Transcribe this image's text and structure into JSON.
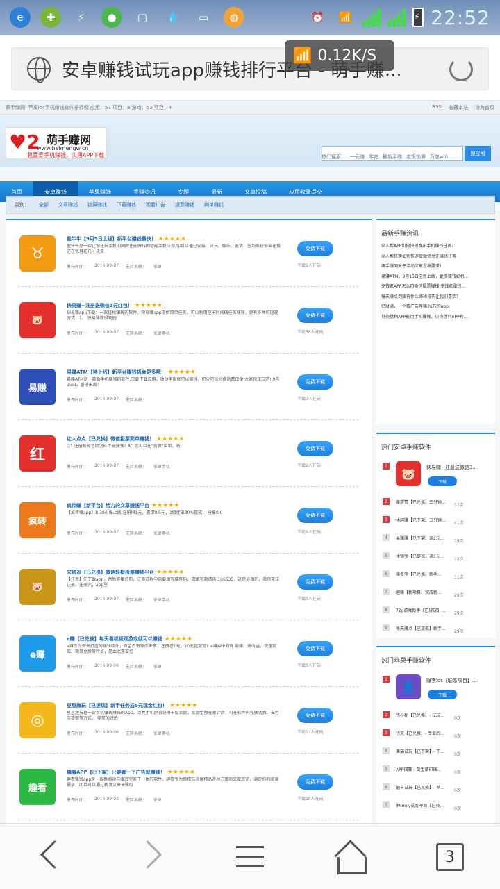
{
  "status": {
    "speed": "0.12K/S",
    "time": "22:52",
    "net1": "3G",
    "net2": "G"
  },
  "browser": {
    "title": "安卓赚钱试玩app赚钱排行平台 - 萌手赚...",
    "tabs_count": "3"
  },
  "site": {
    "top_left": "萌手赚网- 苹果ios手机赚钱软件排行榜   应用：57 项目：8 游戏：53 项目：4",
    "top_links": [
      "RSS",
      "收藏本站",
      "设为首页"
    ],
    "logo_name": "萌手赚网",
    "logo_url": "www.heimengw.cn",
    "logo_slogan": "我喜爱手机赚钱、实用APP下载",
    "search_button": "搜应用",
    "hot_label": "热门搜索：",
    "hot": [
      "一元赚",
      "零花",
      "最新手赚",
      "老板锁屏",
      "万能wifi"
    ],
    "nav": [
      "首页",
      "安卓赚钱",
      "苹果赚钱",
      "手赚资讯",
      "专题",
      "最新",
      "文章投稿",
      "应用收录提交"
    ],
    "cat_label": "类别：",
    "cats": [
      "全部",
      "文章赚钱",
      "锁屏赚钱",
      "下载赚钱",
      "观看广告",
      "投票赚钱",
      "刷单赚钱"
    ]
  },
  "items": [
    {
      "title": "盈牛牛【9月5日上线】新平台赚钱最快！",
      "stars": "★★★★★",
      "desc": "盈牛牛是一款让你在玩手机的同时还能赚钱的智能手机应用,你可以通过安装、试玩、娱乐、邀请、签到等获得零花钱 还在每月花几十块来",
      "date_label": "发布时间：",
      "date": "2016-09-07",
      "sys_label": "支持系统：",
      "sys": "安卓",
      "btn": "免费下载",
      "count": "下载1人在玩",
      "color": "#f29a12",
      "icon": "♉"
    },
    {
      "title": "快易赚~注册送微信3元红包！",
      "stars": "★★★★★",
      "desc": "快易赚app下载：一款轻松赚钱的软件。快易赚app提供简单任务，可以利用空闲时间做任务赚钱，更有多种的提现方式，1。 快易赚获得物园",
      "date_label": "发布时间：",
      "date": "2016-09-07",
      "sys_label": "支持系统：",
      "sys": "安卓手机",
      "btn": "免费下载",
      "count": "下载56人在玩",
      "color": "#e3302c",
      "icon": "🐷"
    },
    {
      "title": "易赚ATM【待上线】新平台赚钱机会更多哦！",
      "stars": "★★★★★",
      "desc": "易赚ATM是一款会手机赚钱的软件,只要下载应用，动动手指就可以赚钱，积分可以兑换话费现金,大家快来玩吧! 9月15日，重磅来袭！",
      "date_label": "发布时间：",
      "date": "2016-09-07",
      "sys_label": "支持系统：",
      "sys": "",
      "btn": "免费下载",
      "count": "下载0人在玩",
      "color": "#2e4fb8",
      "icon": "易赚"
    },
    {
      "title": "红人点点【已兑换】微信投票简单赚钱！",
      "stars": "★★★★★",
      "desc": "Q：注册帐号之后怎样才能赚钱?    A：您可以在\"资源\"菜单，将",
      "date_label": "发布时间：",
      "date": "2016-09-07",
      "sys_label": "支持系统：",
      "sys": "安卓手机",
      "btn": "免费下载",
      "count": "下载2人在玩",
      "color": "#e3302c",
      "icon": "红"
    },
    {
      "title": "疯传赚【新平台】给力的文章赚钱平台",
      "stars": "★★★★★",
      "desc": "【疯传赚app】8.30火爆上线  注册得1元，邀请0.5元，2级徒弟30%提成；  分享0.0",
      "date_label": "发布时间：",
      "date": "2016-09-07",
      "sys_label": "支持系统：",
      "sys": "安卓手机",
      "btn": "免费下载",
      "count": "下载6人在玩",
      "color": "#ec7a1c",
      "icon": "疯转"
    },
    {
      "title": "来钱逛【已兑换】微信轻松投票赚钱平台",
      "stars": "★★★★★",
      "desc": "【注意】先下载app，然后直接注册，注册过程中需要填写推荐码，请填写邀请码:106535，这是必填的，否则无法注册。注册完，app里",
      "date_label": "发布时间：",
      "date": "2016-09-07",
      "sys_label": "支持系统：",
      "sys": "安卓手机",
      "btn": "免费下载",
      "count": "下载3人在玩",
      "color": "#c9961a",
      "icon": "🐷"
    },
    {
      "title": "e赚【已兑换】每天看视频观游戏就可以赚钱",
      "stars": "★★★★★",
      "desc": "e赚专为安卓打造的赚钱软件，真金白银等你来拿，注册送1元，10元起提现！e赚APP拥有 易赚、高收益、快速提现、简单兑换等特点，是由北京掌控",
      "date_label": "发布时间：",
      "date": "2016-09-06",
      "sys_label": "支持系统：",
      "sys": "安卓",
      "btn": "免费下载",
      "count": "下载3人在玩",
      "color": "#1e9be8",
      "icon": "e赚"
    },
    {
      "title": "豆豆趣玩【已提现】新手任务送5元现金红包！",
      "stars": "★★★★★",
      "desc": "豆豆趣玩是一款手机赚钱赚钱的App。点亮手机屏幕获得丰厚奖励，奖励金额在累计后，可在软件内兑换话费、支付宝提现等方式。 非常的好的",
      "date_label": "发布时间：",
      "date": "2016-09-06",
      "sys_label": "支持系统：",
      "sys": "安卓手机",
      "btn": "免费下载",
      "count": "下载17人在玩",
      "color": "#f5b81c",
      "icon": "◎"
    },
    {
      "title": "趣看APP【已下架】只要看一下广告就赚钱！",
      "stars": "★★★★★",
      "desc": "趣看赚钱app是一款集阅读与赚钱完美于一体的软件。趣看专为你精选海量精品各种方面的文章资讯，满足你的阅读需求，而且可以通过转发文章来赚取",
      "date_label": "发布时间：",
      "date": "2016-09-03",
      "sys_label": "支持系统：",
      "sys": "安卓",
      "btn": "免费下载",
      "count": "下载18人在玩",
      "color": "#2db843",
      "icon": "趣看"
    }
  ],
  "news": {
    "title": "最新手赚资讯",
    "list": [
      "众人帮APP如何快速发布手机赚钱任务?",
      "众人帮快速如何快速做微信关注赚钱任务",
      "萌手赚网关于活动文章投稿要求!",
      "易赚ATM，9月15日全新上线，更多赚钱好机...",
      "来钱逛APP怎么用微信投票赚钱,来钱逛赚钱...",
      "每天赚点到底有什么赚钱技巧让我们喜欢？",
      "亿财通，一个看广告年赚36万的app",
      "贝壳借利APP能用手机赚钱，贝壳借利APP有..."
    ]
  },
  "android_rank": {
    "title": "热门安卓手赚软件",
    "top": {
      "num": "1",
      "name": "快易赚~注册送微信3...",
      "btn": "下载",
      "color": "#e3302c",
      "icon": "🐷"
    },
    "list": [
      {
        "num": "2",
        "name": "藤帮赞【已兑换】三分钟...",
        "count": "52次"
      },
      {
        "num": "3",
        "name": "休闲赚【已下架】五分钟...",
        "count": "41次"
      },
      {
        "num": "4",
        "name": "易赚赚【已下架】调2元...",
        "count": "39次"
      },
      {
        "num": "5",
        "name": "体验宝【已提现】调1元...",
        "count": "32次"
      },
      {
        "num": "6",
        "name": "赚多宝【已兑换】新手...",
        "count": "31次"
      },
      {
        "num": "7",
        "name": "趣赚【新项目】完成新...",
        "count": "29次"
      },
      {
        "num": "8",
        "name": "72g游戏助手【已提现】...",
        "count": "29次"
      },
      {
        "num": "9",
        "name": "每天赚点【已提现】新手...",
        "count": "29次"
      }
    ]
  },
  "ios_rank": {
    "title": "热门苹果手赚软件",
    "top": {
      "num": "1",
      "name": "赚客ios【联系项目】...",
      "btn": "下载",
      "color": "#6a4cc7",
      "icon": "👤"
    },
    "list": [
      {
        "num": "2",
        "name": "钱小秘【已兑换】- 试玩...",
        "count": "0次"
      },
      {
        "num": "3",
        "name": "钱夹【已兑换】- 专业的...",
        "count": "0次"
      },
      {
        "num": "4",
        "name": "果猫试玩【已下架】- 下...",
        "count": "0次"
      },
      {
        "num": "5",
        "name": "APP锦赛 - 苗宝帝印赚...",
        "count": "0次"
      },
      {
        "num": "6",
        "name": "肥羊试玩【已兑换】- 苹...",
        "count": "0次"
      },
      {
        "num": "7",
        "name": "iMoney试客平台【已兑...",
        "count": "0次"
      }
    ]
  }
}
